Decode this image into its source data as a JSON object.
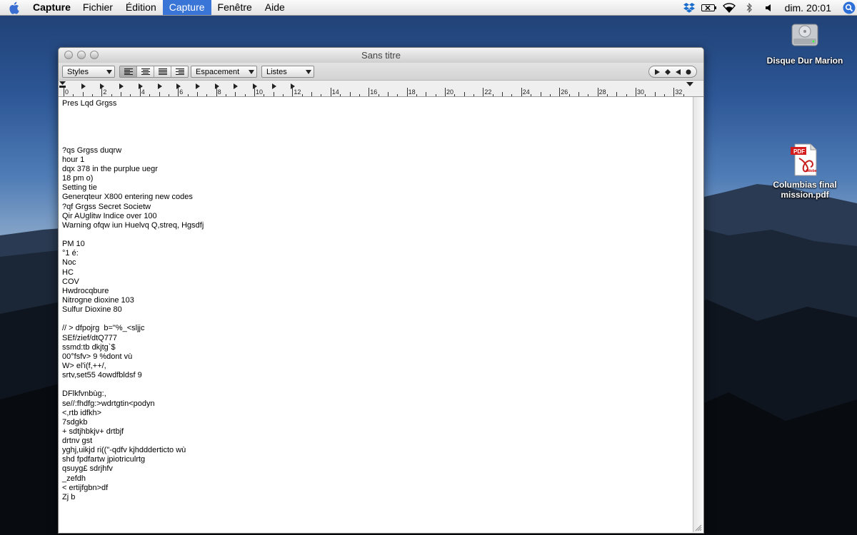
{
  "menubar": {
    "app_name": "Capture",
    "items": [
      "Fichier",
      "Édition",
      "Capture",
      "Fenêtre",
      "Aide"
    ],
    "active_item": "Capture",
    "clock": "dim. 20:01",
    "status_icons": [
      "dropbox-icon",
      "battery-icon",
      "wifi-icon",
      "bluetooth-icon",
      "volume-icon"
    ]
  },
  "desktop": {
    "icons": [
      {
        "label": "Disque Dur Marion",
        "icon": "hard-drive-icon"
      },
      {
        "label": "Columbias final mission.pdf",
        "icon": "pdf-file-icon",
        "badge": "PDF",
        "brand": "Adobe"
      }
    ]
  },
  "window": {
    "title": "Sans titre",
    "toolbar": {
      "styles_label": "Styles",
      "spacing_label": "Espacement",
      "lists_label": "Listes",
      "alignment_selected": "left"
    },
    "ruler": {
      "numbers": [
        "0",
        "2",
        "4",
        "6",
        "8",
        "10",
        "12",
        "14",
        "16",
        "18",
        "20",
        "22",
        "24",
        "26",
        "28",
        "30",
        "32"
      ]
    },
    "document_lines": [
      "Pres Lqd Grgss",
      "",
      "",
      "",
      "",
      "?qs Grgss duqrw",
      "hour 1",
      "dqx 378 in the purplue uegr",
      "18 pm o)",
      "Setting tie",
      "Generqteur X800 entering new codes",
      "?qf Grgss Secret Societw",
      "Qir AUglitw Indice over 100",
      "Warning ofqw iun Huelvq Q,streq, Hgsdfj",
      "",
      "PM 10",
      "°1 é:",
      "Noc",
      "HC",
      "COV",
      "Hwdrocqbure",
      "Nitrogne dioxine 103",
      "Sulfur Dioxine 80",
      "",
      "// > dfpojrg  b=\"%_<sljjc",
      "SEf/zief/dtQ777",
      "ssmd:tb dkjtg`$",
      "00°fsfv> 9 %dont vù",
      "W> el'i(f,++/,",
      "srtv,set55 4owdfbldsf 9",
      "",
      "DFlkfvnbùg:,",
      "se//:fhdfg:>wdrtgtin<podyn",
      "<,rtb idfkh>",
      "7sdgkb",
      "+ sdtjhbkjv+ drtbjf",
      "drtnv gst",
      "yghj,uikjd ri((\"-qdfv kjhddderticto wù",
      "shd fpdfartw jpiotriculrtg",
      "qsuyg£ sdrjhfv",
      "_zefdh",
      "< ertijfgbn>df",
      "Zj b"
    ]
  }
}
